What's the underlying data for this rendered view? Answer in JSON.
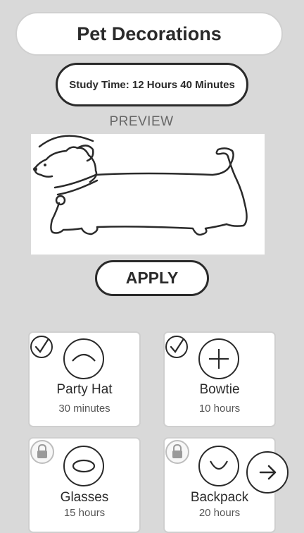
{
  "header": {
    "title": "Pet Decorations"
  },
  "study": {
    "label": "Study Time: 12 Hours 40 Minutes"
  },
  "preview": {
    "label": "PREVIEW"
  },
  "apply": {
    "label": "APPLY"
  },
  "items": [
    {
      "name": "Party Hat",
      "time": "30 minutes",
      "status": "selected",
      "icon": "party-hat-icon"
    },
    {
      "name": "Bowtie",
      "time": "10 hours",
      "status": "selected",
      "icon": "bowtie-icon"
    },
    {
      "name": "Glasses",
      "time": "15 hours",
      "status": "locked",
      "icon": "glasses-icon"
    },
    {
      "name": "Backpack",
      "time": "20 hours",
      "status": "locked",
      "icon": "backpack-icon"
    }
  ],
  "colors": {
    "background": "#d9d9d9",
    "card": "#ffffff",
    "ink": "#2a2a2a"
  }
}
